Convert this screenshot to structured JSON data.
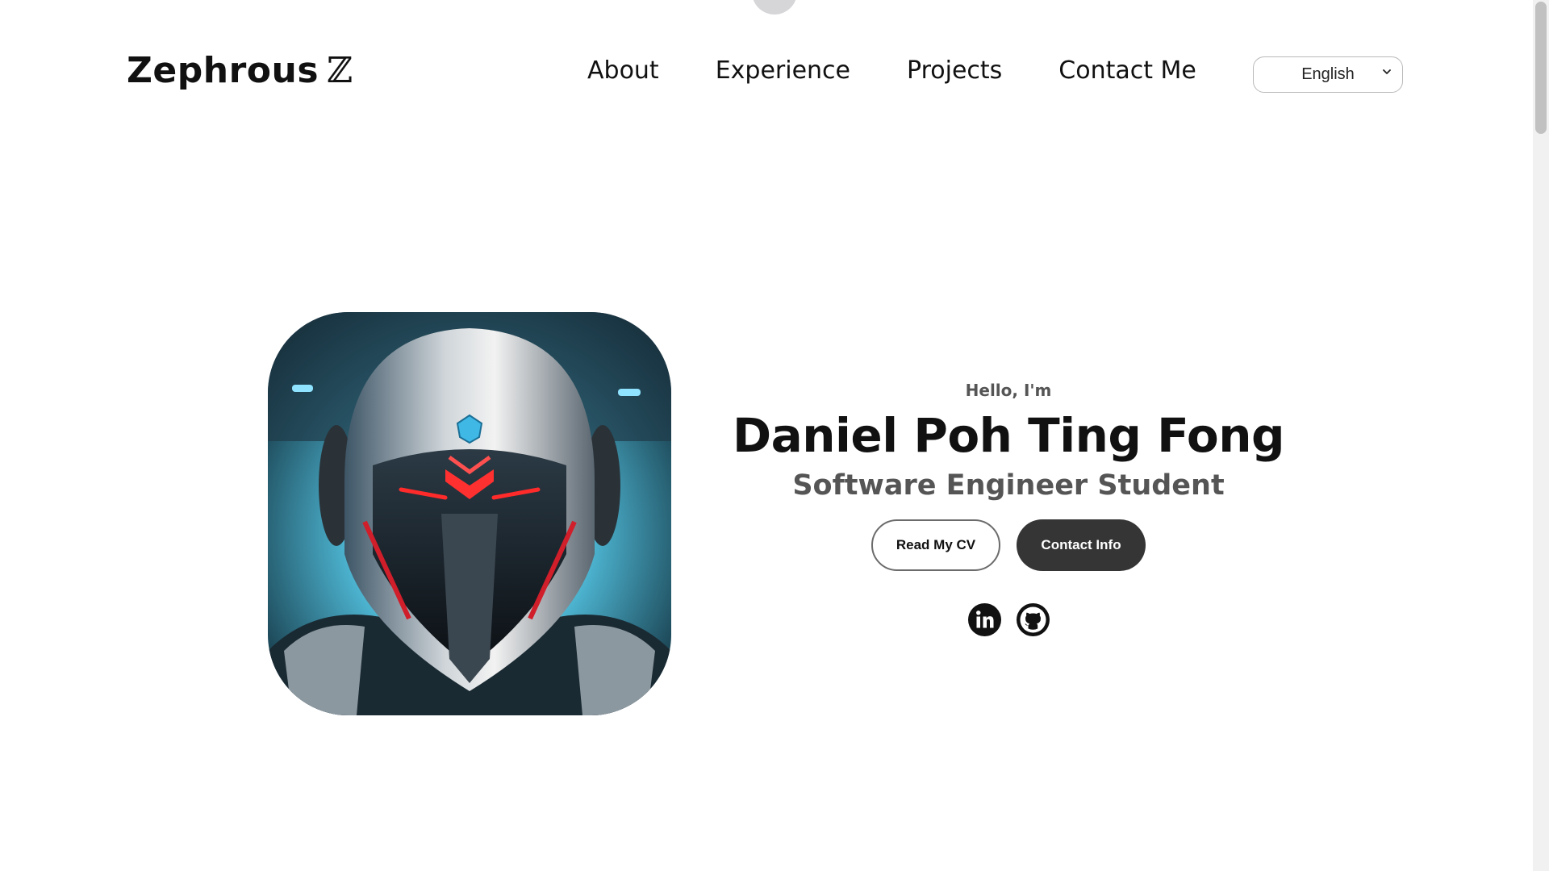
{
  "brand": {
    "name": "Zephrous",
    "mark": "ℤ"
  },
  "nav": {
    "items": [
      {
        "label": "About"
      },
      {
        "label": "Experience"
      },
      {
        "label": "Projects"
      },
      {
        "label": "Contact Me"
      }
    ]
  },
  "language_select": {
    "selected": "English"
  },
  "hero": {
    "greeting": "Hello, I'm",
    "name": "Daniel Poh Ting Fong",
    "title": "Software Engineer Student",
    "buttons": {
      "cv_label": "Read My CV",
      "contact_label": "Contact Info"
    },
    "avatar_icon": "robot-helmet-avatar",
    "socials": [
      {
        "icon": "linkedin-icon"
      },
      {
        "icon": "github-icon"
      }
    ]
  },
  "colors": {
    "accent_dark": "#353535",
    "muted_text": "#555555",
    "visor_red": "#e22a2a",
    "helmet_cyan": "#4fb9d6"
  }
}
